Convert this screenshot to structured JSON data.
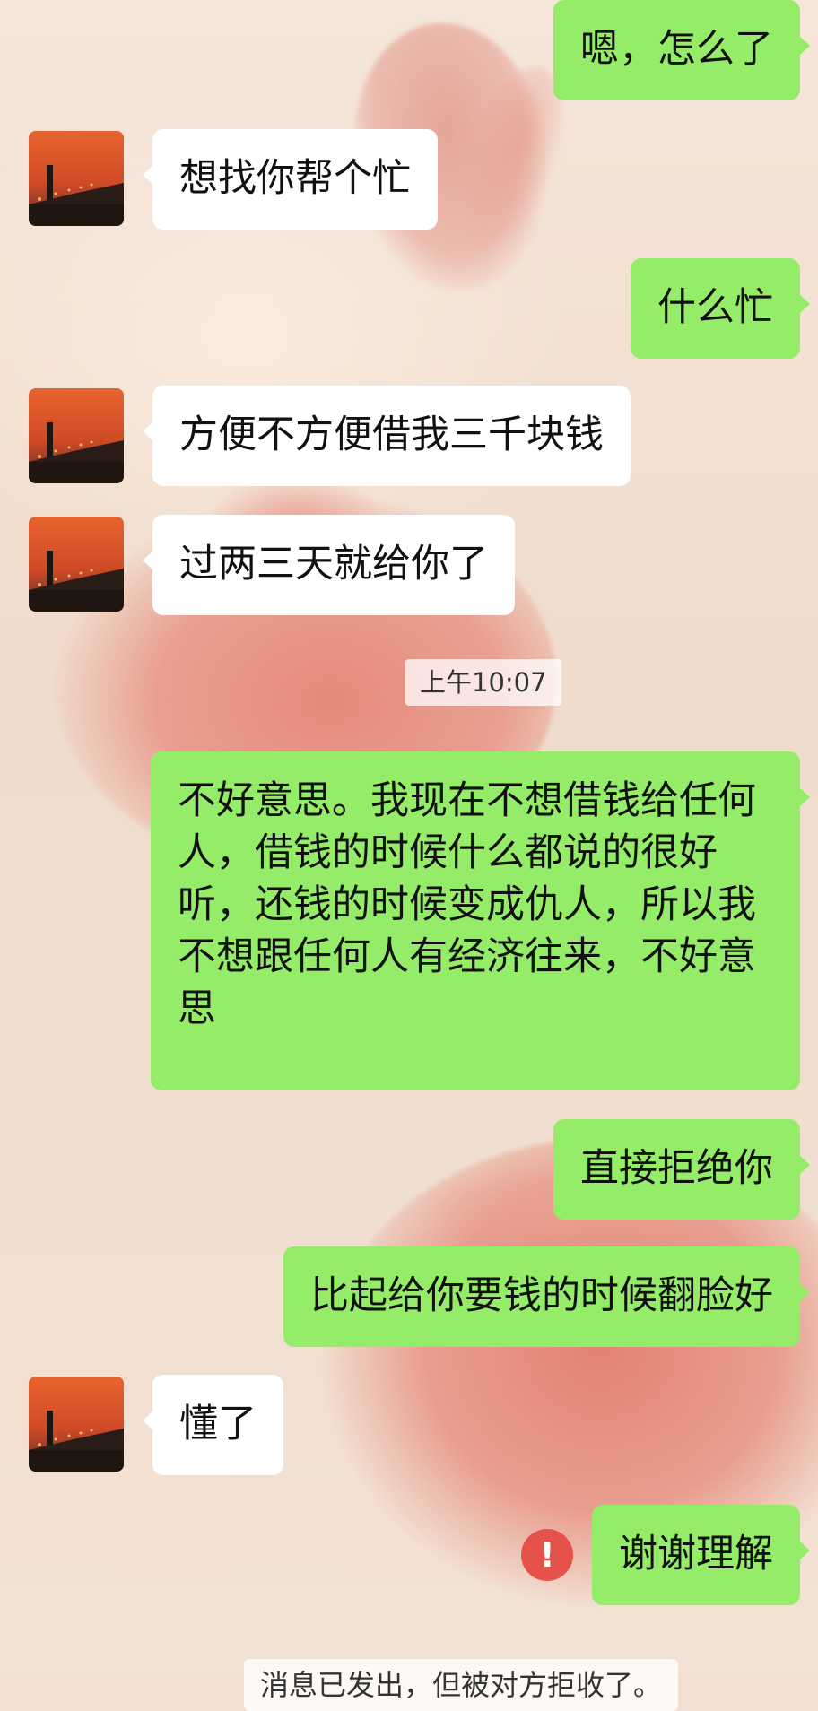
{
  "messages": [
    {
      "side": "out",
      "text": "嗯，怎么了"
    },
    {
      "side": "in",
      "text": "想找你帮个忙"
    },
    {
      "side": "out",
      "text": "什么忙"
    },
    {
      "side": "in",
      "text": "方便不方便借我三千块钱"
    },
    {
      "side": "in",
      "text": "过两三天就给你了"
    },
    {
      "side": "out",
      "text": "不好意思。我现在不想借钱给任何人，借钱的时候什么都说的很好听，还钱的时候变成仇人，所以我不想跟任何人有经济往来，不好意思"
    },
    {
      "side": "out",
      "text": "直接拒绝你"
    },
    {
      "side": "out",
      "text": "比起给你要钱的时候翻脸好"
    },
    {
      "side": "in",
      "text": "懂了"
    },
    {
      "side": "out",
      "text": "谢谢理解",
      "status": "failed"
    }
  ],
  "timestamp": "上午10:07",
  "failed_badge": "!",
  "system_notice": "消息已发出，但被对方拒收了。",
  "colors": {
    "outgoing_bubble": "#95ec69",
    "incoming_bubble": "#ffffff",
    "error_badge": "#e5524b"
  },
  "avatar_icon": "sunset-tower-icon"
}
